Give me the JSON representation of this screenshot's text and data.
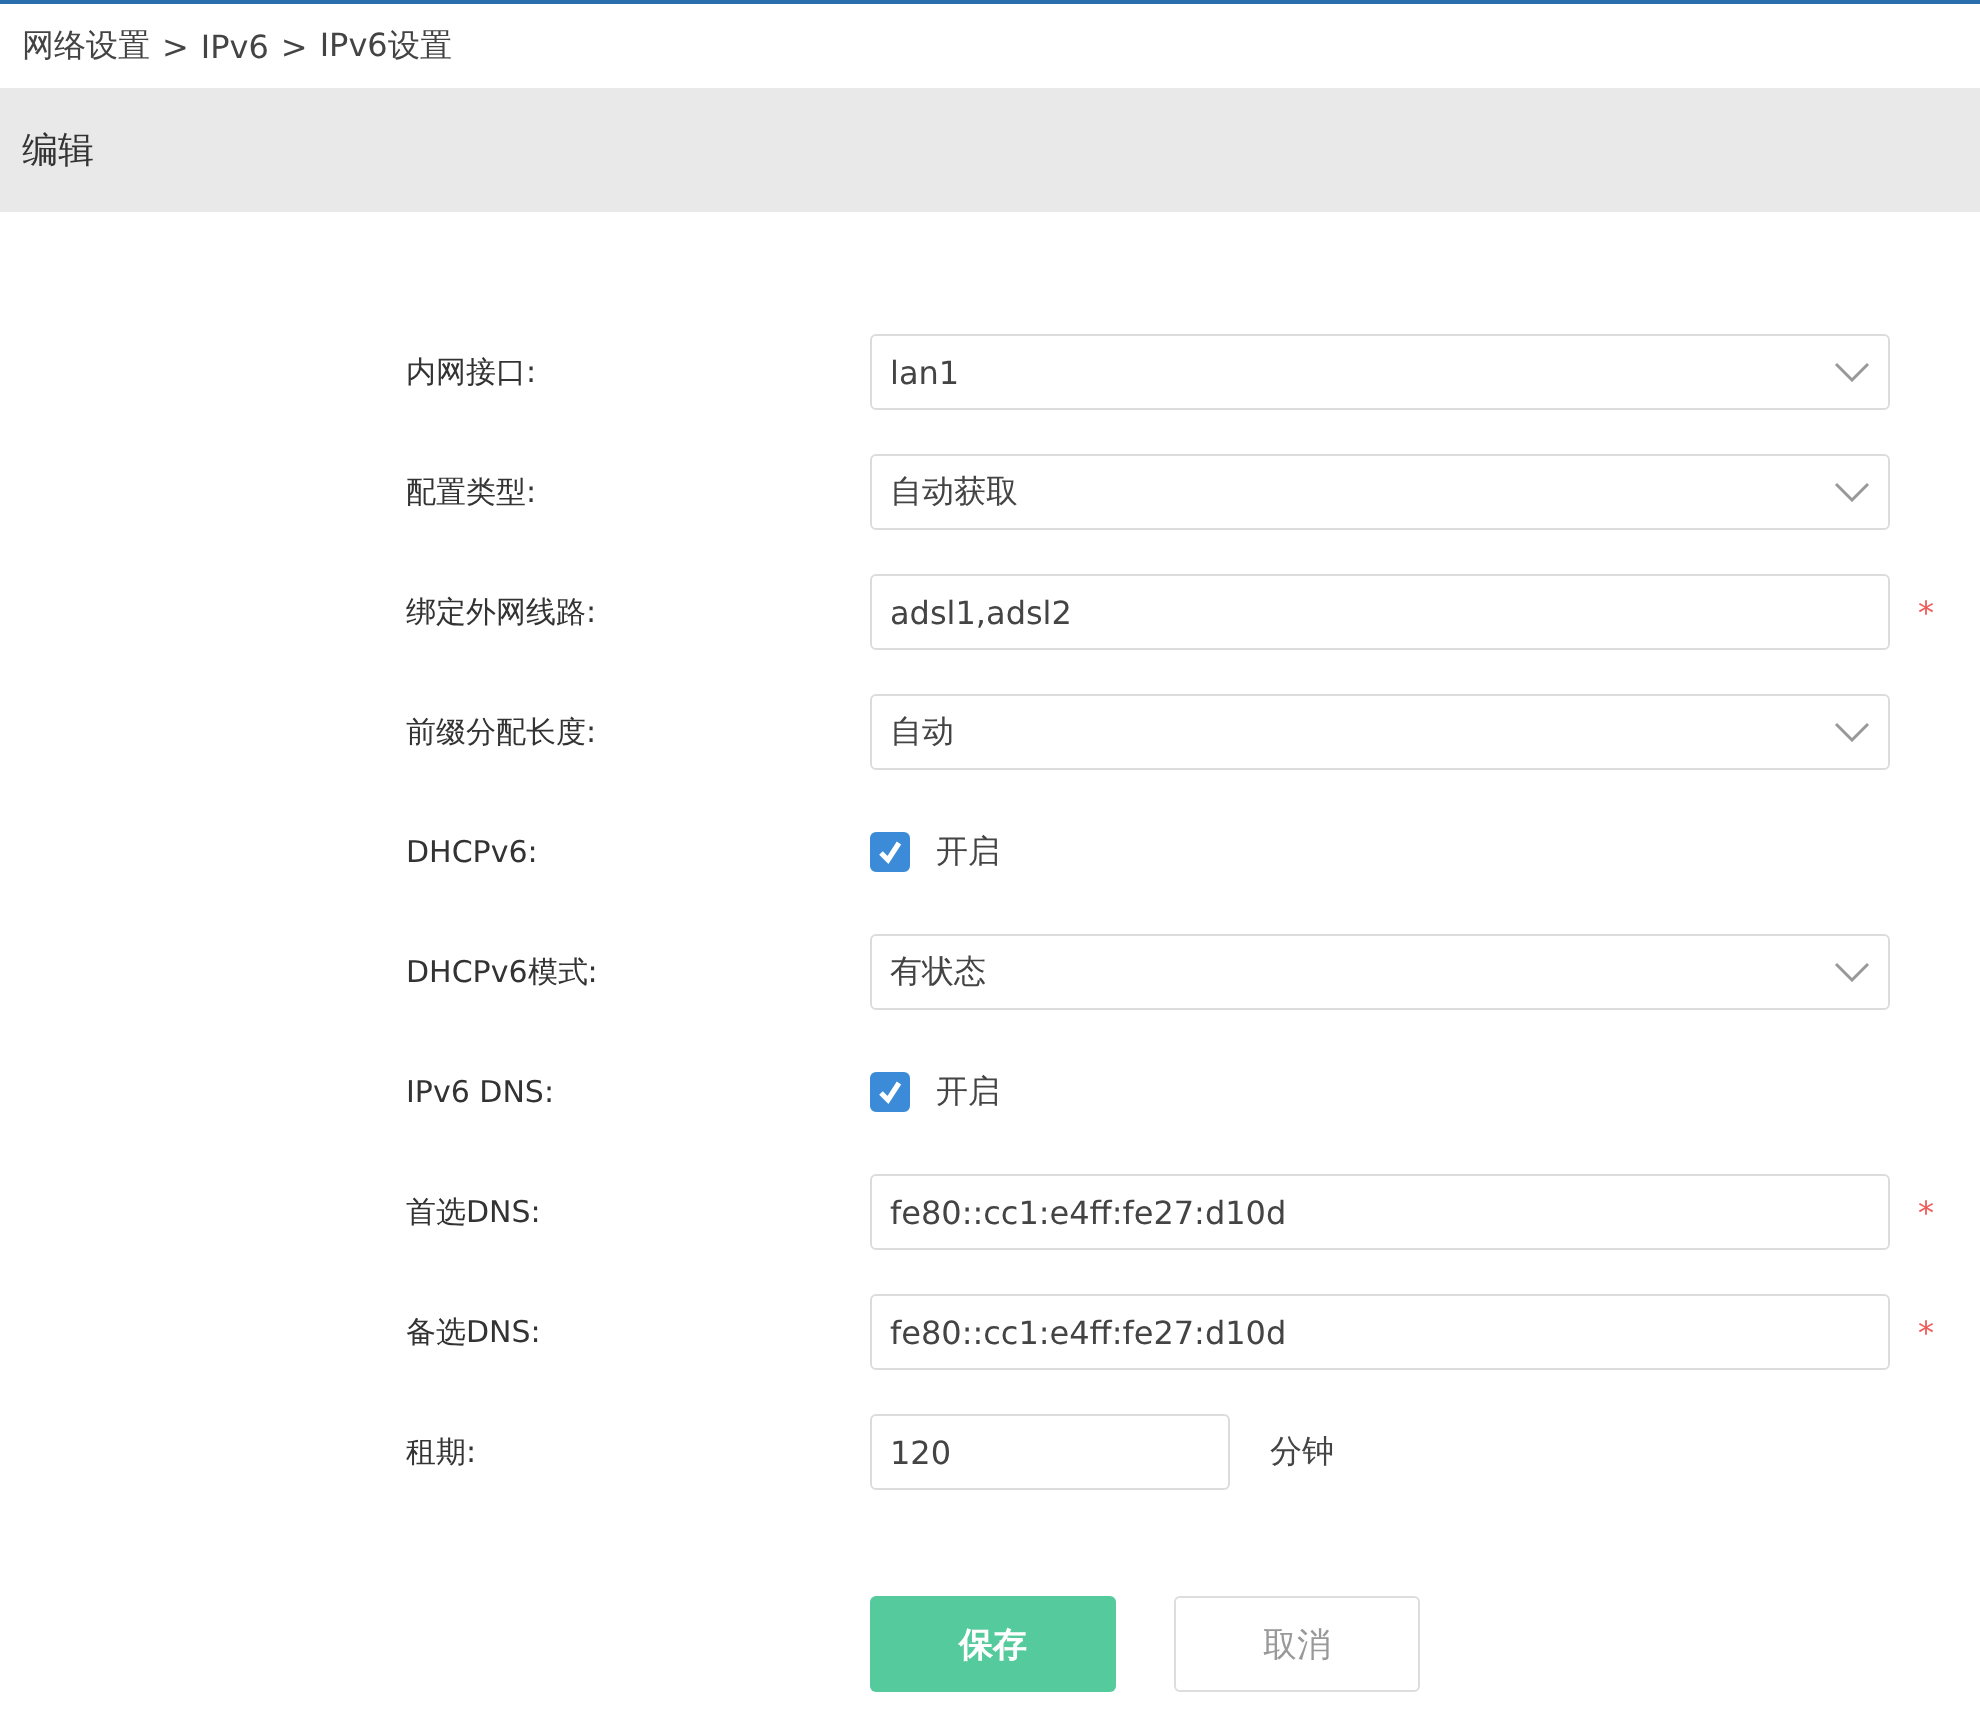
{
  "breadcrumb": [
    "网络设置",
    ">",
    "IPv6",
    ">",
    "IPv6设置"
  ],
  "panel_title": "编辑",
  "fields": [
    {
      "label": "内网接口:",
      "kind": "select",
      "value": "lan1"
    },
    {
      "label": "配置类型:",
      "kind": "select",
      "value": "自动获取"
    },
    {
      "label": "绑定外网线路:",
      "kind": "text",
      "value": "adsl1,adsl2",
      "required_mark": "*"
    },
    {
      "label": "前缀分配长度:",
      "kind": "select",
      "value": "自动"
    },
    {
      "label": "DHCPv6:",
      "kind": "checkbox",
      "checked": true,
      "option": "开启"
    },
    {
      "label": "DHCPv6模式:",
      "kind": "select",
      "value": "有状态"
    },
    {
      "label": "IPv6 DNS:",
      "kind": "checkbox",
      "checked": true,
      "option": "开启"
    },
    {
      "label": "首选DNS:",
      "kind": "text",
      "value": "fe80::cc1:e4ff:fe27:d10d",
      "required_mark": "*"
    },
    {
      "label": "备选DNS:",
      "kind": "text",
      "value": "fe80::cc1:e4ff:fe27:d10d",
      "required_mark": "*"
    },
    {
      "label": "租期:",
      "kind": "short",
      "value": "120",
      "unit": "分钟"
    }
  ],
  "buttons": [
    {
      "label": "保存",
      "kind": "primary"
    },
    {
      "label": "取消",
      "kind": "secondary"
    }
  ]
}
